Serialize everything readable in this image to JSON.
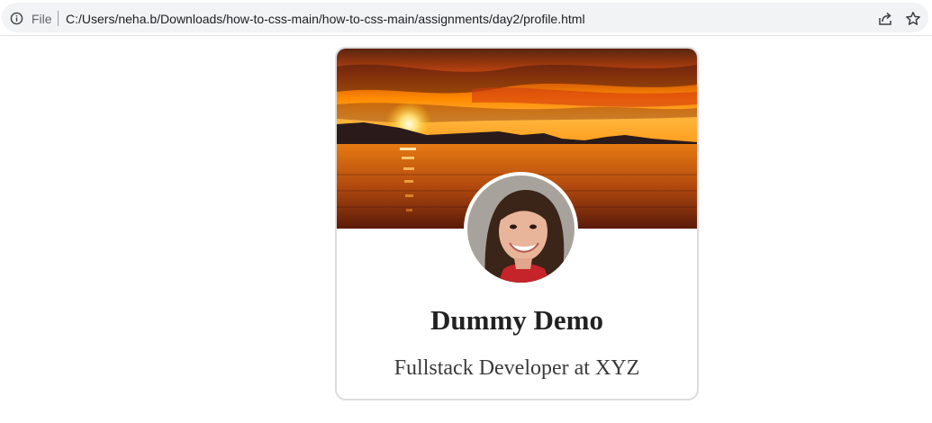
{
  "browser": {
    "scheme_label": "File",
    "url": "C:/Users/neha.b/Downloads/how-to-css-main/how-to-css-main/assignments/day2/profile.html",
    "icons": [
      "info-icon",
      "share-icon",
      "star-icon"
    ]
  },
  "profile": {
    "name": "Dummy Demo",
    "role": "Fullstack Developer at XYZ",
    "cover_image": "sunset-over-water",
    "avatar_image": "smiling-woman-portrait"
  },
  "colors": {
    "card_border": "#dcdcdc",
    "name_text": "#222222",
    "role_text": "#3a3a3a",
    "sky_top": "#6b2a10",
    "sky_glow": "#ff8a00"
  }
}
